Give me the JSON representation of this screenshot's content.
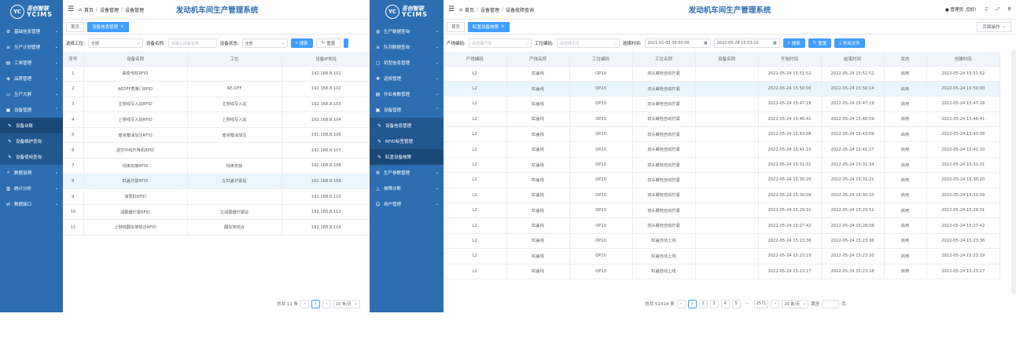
{
  "panel1": {
    "logo": {
      "cn": "吾创智联",
      "en": "YCIMS",
      "mark": "YC"
    },
    "menu": [
      {
        "label": "基础信息管理",
        "icon": "gear-icon",
        "type": "parent"
      },
      {
        "label": "生产计划管理",
        "icon": "list-icon",
        "type": "parent"
      },
      {
        "label": "工单管理",
        "icon": "doc-icon",
        "type": "parent"
      },
      {
        "label": "品质管理",
        "icon": "shield-icon",
        "type": "parent"
      },
      {
        "label": "生产大屏",
        "icon": "monitor-icon",
        "type": "parent"
      },
      {
        "label": "设备管理",
        "icon": "device-icon",
        "type": "parent-open"
      },
      {
        "label": "设备台账",
        "icon": "pen-icon",
        "type": "sub-active"
      },
      {
        "label": "设备维护查询",
        "icon": "pen-icon",
        "type": "sub"
      },
      {
        "label": "设备使用查询",
        "icon": "pen-icon",
        "type": "sub"
      },
      {
        "label": "数据追溯",
        "icon": "search-icon",
        "type": "parent"
      },
      {
        "label": "统计分析",
        "icon": "chart-icon",
        "type": "parent"
      },
      {
        "label": "数据接口",
        "icon": "link-icon",
        "type": "parent"
      }
    ],
    "breadcrumb": [
      "首页",
      "设备管理",
      "设备管理"
    ],
    "title": "发动机车间生产管理系统",
    "tabs": [
      {
        "label": "首页"
      },
      {
        "label": "设备信息管理"
      }
    ],
    "filters": {
      "station_label": "选择工位:",
      "station_value": "全部",
      "name_label": "设备名称:",
      "name_placeholder": "请输入设备名称",
      "status_label": "设备状态:",
      "status_value": "全部",
      "search": "搜索",
      "reset": "重置"
    },
    "columns": [
      "序号",
      "设备名称",
      "工位",
      "设备IP地址"
    ],
    "rows": [
      [
        "1",
        "曲变传缸RFID",
        "",
        "192.168.8.101"
      ],
      [
        "2",
        "AEOFF质量门RFID",
        "AE-OFF",
        "192.168.8.102"
      ],
      [
        "3",
        "主侧线写入站RFID",
        "主侧线写入站",
        "192.168.8.103"
      ],
      [
        "4",
        "上侧线写入站RFID",
        "上侧线写入站",
        "192.168.8.104"
      ],
      [
        "5",
        "废液箱油加注RFID",
        "废液箱油加注",
        "192.168.8.106"
      ],
      [
        "6",
        "进空中线升降机RFID",
        "",
        "192.168.8.107"
      ],
      [
        "7",
        "线束扣接RFID",
        "线束安装",
        "192.168.8.108"
      ],
      [
        "8",
        "缸盖拧紧RFID",
        "左缸盖拧紧站",
        "192.168.8.109"
      ],
      [
        "9",
        "油泵缸RFID",
        "",
        "192.168.8.110"
      ],
      [
        "10",
        "减震器拧紧RFID",
        "左减震器拧紧站",
        "192.168.8.112"
      ],
      [
        "11",
        "上侧线翻车架结合RFID",
        "翻车架结合",
        "192.168.8.114"
      ]
    ],
    "highlight_row": 7,
    "pager": {
      "total": "总共 11 条",
      "current": "1",
      "size": "10 条/页"
    }
  },
  "panel2": {
    "logo": {
      "cn": "吾创智联",
      "en": "YCIMS",
      "mark": "YC"
    },
    "menu": [
      {
        "label": "生产数据查询",
        "icon": "database-icon",
        "type": "parent"
      },
      {
        "label": "队列数据查询",
        "icon": "list-icon",
        "type": "parent"
      },
      {
        "label": "机型信息管理",
        "icon": "box-icon",
        "type": "parent"
      },
      {
        "label": "返修管理",
        "icon": "tool-icon",
        "type": "parent"
      },
      {
        "label": "作业参数管理",
        "icon": "doc-icon",
        "type": "parent"
      },
      {
        "label": "设备管理",
        "icon": "device-icon",
        "type": "parent-open"
      },
      {
        "label": "设备信息管理",
        "icon": "pen-icon",
        "type": "sub"
      },
      {
        "label": "RFID标签管理",
        "icon": "pen-icon",
        "type": "sub"
      },
      {
        "label": "缸盖设备故障",
        "icon": "pen-icon",
        "type": "sub-active"
      },
      {
        "label": "生产参数管理",
        "icon": "gear-icon",
        "type": "parent"
      },
      {
        "label": "故障诊断",
        "icon": "warning-icon",
        "type": "parent"
      },
      {
        "label": "用户管理",
        "icon": "user-icon",
        "type": "parent"
      }
    ],
    "breadcrumb": [
      "首页",
      "设备管理",
      "设备故障查询"
    ],
    "title": "发动机车间生产管理系统",
    "user": "管理员 ,您好!",
    "tabs": [
      {
        "label": "首页"
      },
      {
        "label": "缸盖设备故障"
      }
    ],
    "page_ops": "页面操作",
    "filters": {
      "line_label": "产线编码:",
      "line_placeholder": "请选择产线",
      "station_label": "工位编码:",
      "station_placeholder": "请选择工位",
      "time_label": "选择时间:",
      "time_start": "2021-01-01 00:00:00",
      "time_end": "2022-05-24 15:53:20",
      "search": "搜索",
      "reset": "重置",
      "export": "导出文件"
    },
    "columns": [
      "产线编码",
      "产线名称",
      "工位编码",
      "工位名称",
      "设备名称",
      "开始时间",
      "结束时间",
      "状态",
      "创建时间"
    ],
    "rows": [
      [
        "L2",
        "缸盖线",
        "OP20",
        "双头螺栓自动拧紧",
        "",
        "2022-05-24 15:51:52",
        "2022-05-24 15:51:52",
        "启用",
        "2022-05-24 15:51:52"
      ],
      [
        "L2",
        "缸盖线",
        "OP20",
        "双头螺栓自动拧紧",
        "",
        "2022-05-24 15:50:00",
        "2022-05-24 15:50:14",
        "启用",
        "2022-05-24 15:50:00"
      ],
      [
        "L2",
        "缸盖线",
        "OP20",
        "双头螺栓自动拧紧",
        "",
        "2022-05-24 15:47:18",
        "2022-05-24 15:47:19",
        "启用",
        "2022-05-24 15:47:18"
      ],
      [
        "L2",
        "缸盖线",
        "OP20",
        "双头螺栓自动拧紧",
        "",
        "2022-05-24 15:46:41",
        "2022-05-24 15:46:59",
        "启用",
        "2022-05-24 15:46:41"
      ],
      [
        "L2",
        "缸盖线",
        "OP20",
        "双头螺栓自动拧紧",
        "",
        "2022-05-24 15:43:08",
        "2022-05-24 15:43:09",
        "启用",
        "2022-05-24 15:43:08"
      ],
      [
        "L2",
        "缸盖线",
        "OP20",
        "双头螺栓自动拧紧",
        "",
        "2022-05-24 15:41:10",
        "2022-05-24 15:41:27",
        "启用",
        "2022-05-24 15:41:10"
      ],
      [
        "L2",
        "缸盖线",
        "OP20",
        "双头螺栓自动拧紧",
        "",
        "2022-05-24 15:31:31",
        "2022-05-24 15:31:34",
        "启用",
        "2022-05-24 15:31:31"
      ],
      [
        "L2",
        "缸盖线",
        "OP20",
        "双头螺栓自动拧紧",
        "",
        "2022-05-24 15:30:20",
        "2022-05-24 15:31:21",
        "启用",
        "2022-05-24 15:30:20"
      ],
      [
        "L2",
        "缸盖线",
        "OP20",
        "双头螺栓自动拧紧",
        "",
        "2022-05-24 15:30:09",
        "2022-05-24 15:30:10",
        "启用",
        "2022-05-24 15:30:09"
      ],
      [
        "L2",
        "缸盖线",
        "OP20",
        "双头螺栓自动拧紧",
        "",
        "2022-05-24 15:29:31",
        "2022-05-24 15:29:51",
        "启用",
        "2022-05-24 15:29:31"
      ],
      [
        "L2",
        "缸盖线",
        "OP20",
        "双头螺栓自动拧紧",
        "",
        "2022-05-24 15:27:42",
        "2022-05-24 15:28:08",
        "启用",
        "2022-05-24 15:27:42"
      ],
      [
        "L2",
        "缸盖线",
        "OP10",
        "缸盖自动上线",
        "",
        "2022-05-24 15:23:36",
        "2022-05-24 15:23:36",
        "启用",
        "2022-05-24 15:23:36"
      ],
      [
        "L2",
        "缸盖线",
        "OP10",
        "缸盖自动上线",
        "",
        "2022-05-24 15:23:19",
        "2022-05-24 15:23:20",
        "启用",
        "2022-05-24 15:23:19"
      ],
      [
        "L2",
        "缸盖线",
        "OP10",
        "缸盖自动上线",
        "",
        "2022-05-24 15:23:17",
        "2022-05-24 15:23:18",
        "启用",
        "2022-05-24 15:23:17"
      ]
    ],
    "highlight_row": 1,
    "pager": {
      "total": "总共 51414 条",
      "pages": [
        "1",
        "2",
        "3",
        "4",
        "5"
      ],
      "ellipsis": "···",
      "last": "2571",
      "size": "20 条/页",
      "jump_label": "跳至",
      "jump_unit": "页"
    }
  }
}
